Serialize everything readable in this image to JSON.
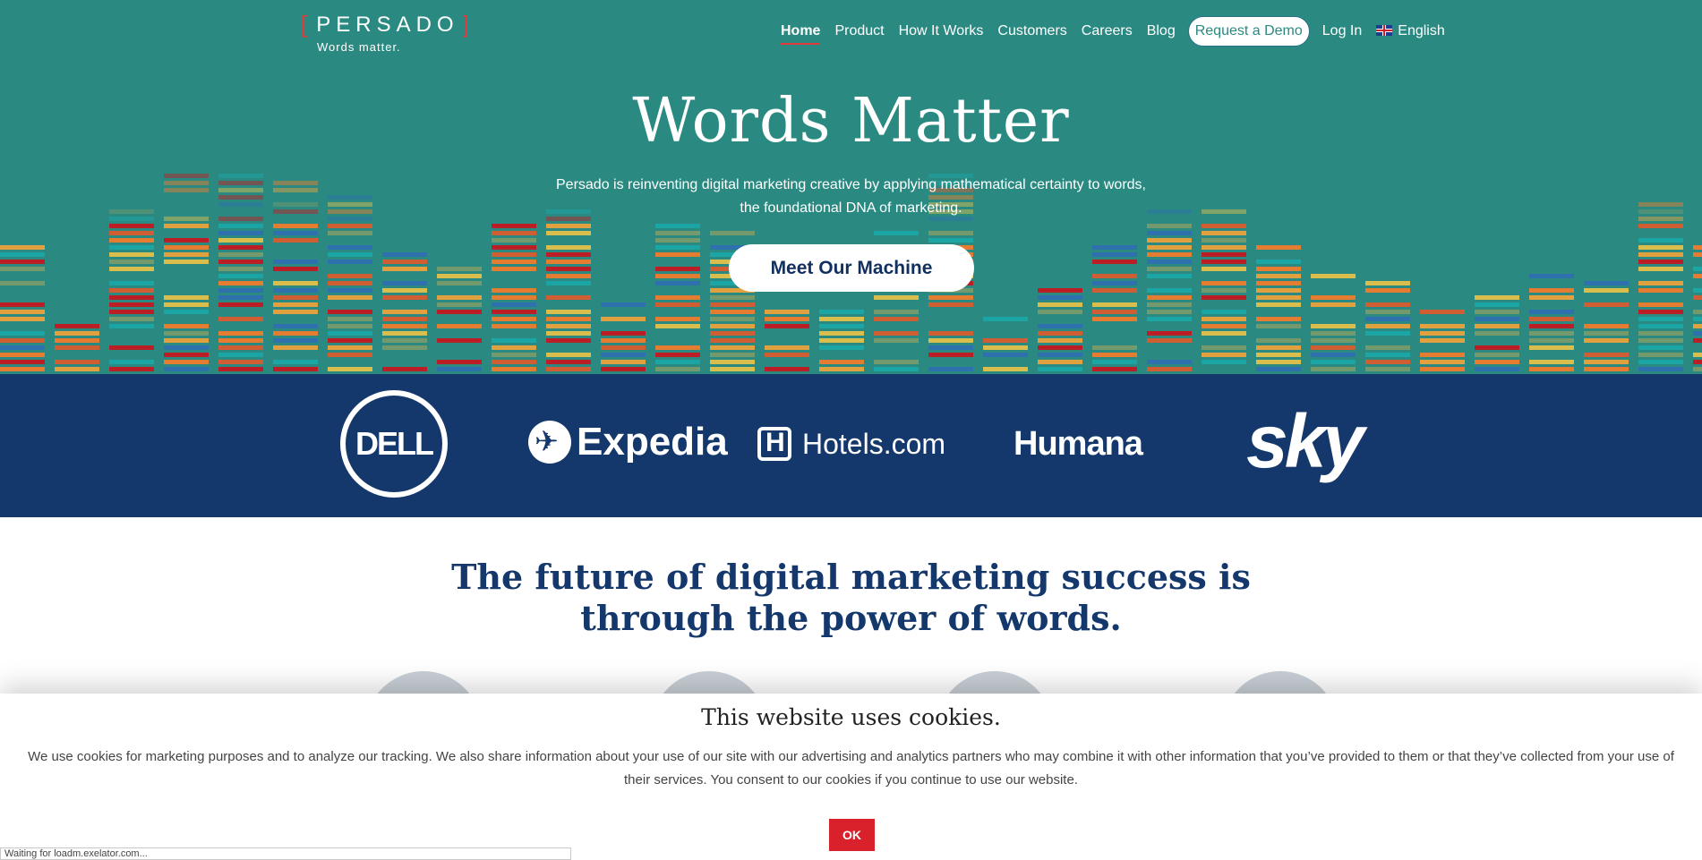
{
  "brand": {
    "name": "PERSADO",
    "tagline": "Words matter."
  },
  "nav": {
    "items": [
      "Home",
      "Product",
      "How It Works",
      "Customers",
      "Careers",
      "Blog"
    ],
    "demo": "Request a Demo",
    "login": "Log In",
    "language": "English"
  },
  "hero": {
    "title": "Words Matter",
    "subtitle": "Persado is reinventing digital marketing creative by applying mathematical certainty to words, the foundational DNA of marketing.",
    "cta": "Meet Our Machine"
  },
  "clients": [
    "DELL",
    "Expedia",
    "Hotels.com",
    "Humana",
    "sky"
  ],
  "main": {
    "headline_line1": "The future of digital marketing success is",
    "headline_line2": "through the power of words."
  },
  "cookie": {
    "title": "This website uses cookies.",
    "text": "We use cookies for marketing purposes and to analyze our tracking. We also share information about your use of our site with our advertising and analytics partners who may combine it with other information that you’ve provided to them or that they’ve collected from your use of their services. You consent to our cookies if you continue to use our website.",
    "ok": "OK"
  },
  "status_bar": "Waiting for loadm.exelator.com...",
  "colors": {
    "teal": "#2a8a82",
    "navy": "#14386b",
    "red": "#d8212a"
  }
}
